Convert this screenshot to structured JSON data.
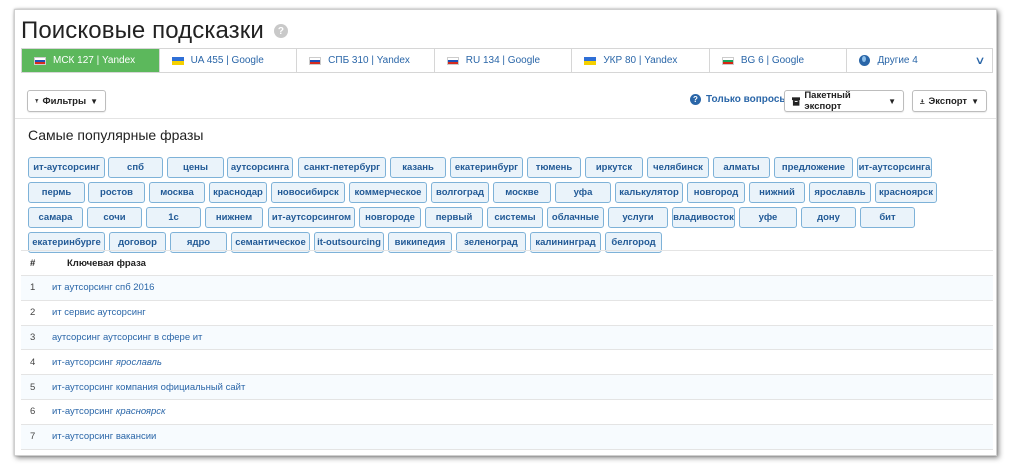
{
  "page": {
    "title": "Поисковые подсказки",
    "help_glyph": "?"
  },
  "tabs": [
    {
      "label": "МСК 127 | Yandex",
      "flag": "ru",
      "active": true
    },
    {
      "label": "UA 455 | Google",
      "flag": "ua",
      "active": false
    },
    {
      "label": "СПБ 310 | Yandex",
      "flag": "ru",
      "active": false
    },
    {
      "label": "RU 134 | Google",
      "flag": "ru",
      "active": false
    },
    {
      "label": "УКР 80 | Yandex",
      "flag": "ua",
      "active": false
    },
    {
      "label": "BG 6 | Google",
      "flag": "bg",
      "active": false
    },
    {
      "label": "Другие 4",
      "icon": "globe-icon",
      "active": false
    }
  ],
  "toolbar": {
    "filters_label": "Фильтры",
    "questions_label": "Только вопросы",
    "batch_export_label": "Пакетный экспорт",
    "export_label": "Экспорт"
  },
  "popular": {
    "title": "Самые популярные фразы",
    "rows": [
      [
        "ит-аутсорсинг",
        "спб",
        "цены",
        "аутсорсинга",
        "санкт-петербург",
        "казань",
        "екатеринбург",
        "тюмень",
        "иркутск",
        "челябинск",
        "алматы",
        "предложение",
        "ит-аутсорсинга"
      ],
      [
        "пермь",
        "ростов",
        "москва",
        "краснодар",
        "новосибирск",
        "коммерческое",
        "волгоград",
        "москве",
        "уфа",
        "калькулятор",
        "новгород",
        "нижний",
        "ярославль",
        "красноярск"
      ],
      [
        "самара",
        "сочи",
        "1с",
        "нижнем",
        "ит-аутсорсингом",
        "новгороде",
        "первый",
        "системы",
        "облачные",
        "услуги",
        "владивосток",
        "уфе",
        "дону",
        "бит"
      ],
      [
        "екатеринбурге",
        "договор",
        "ядро",
        "семантическое",
        "it-outsourcing",
        "википедия",
        "зеленоград",
        "калининград",
        "белгород"
      ]
    ]
  },
  "table": {
    "col_num": "#",
    "col_phrase": "Ключевая фраза",
    "rows": [
      {
        "num": "1",
        "phrase": "ит аутсорсинг спб 2016",
        "suffix": ""
      },
      {
        "num": "2",
        "phrase": "ит сервис аутсорсинг",
        "suffix": ""
      },
      {
        "num": "3",
        "phrase": "аутсорсинг аутсорсинг в сфере ит",
        "suffix": ""
      },
      {
        "num": "4",
        "phrase": "ит-аутсорсинг",
        "suffix": "ярославль"
      },
      {
        "num": "5",
        "phrase": "ит-аутсорсинг компания официальный сайт",
        "suffix": ""
      },
      {
        "num": "6",
        "phrase": "ит-аутсорсинг",
        "suffix": "красноярск"
      },
      {
        "num": "7",
        "phrase": "ит-аутсорсинг вакансии",
        "suffix": ""
      }
    ]
  },
  "colors": {
    "active_tab": "#5cb85c",
    "link": "#2a66a8",
    "chip_bg": "#eaf3fa",
    "chip_border": "#7eb2d8"
  }
}
